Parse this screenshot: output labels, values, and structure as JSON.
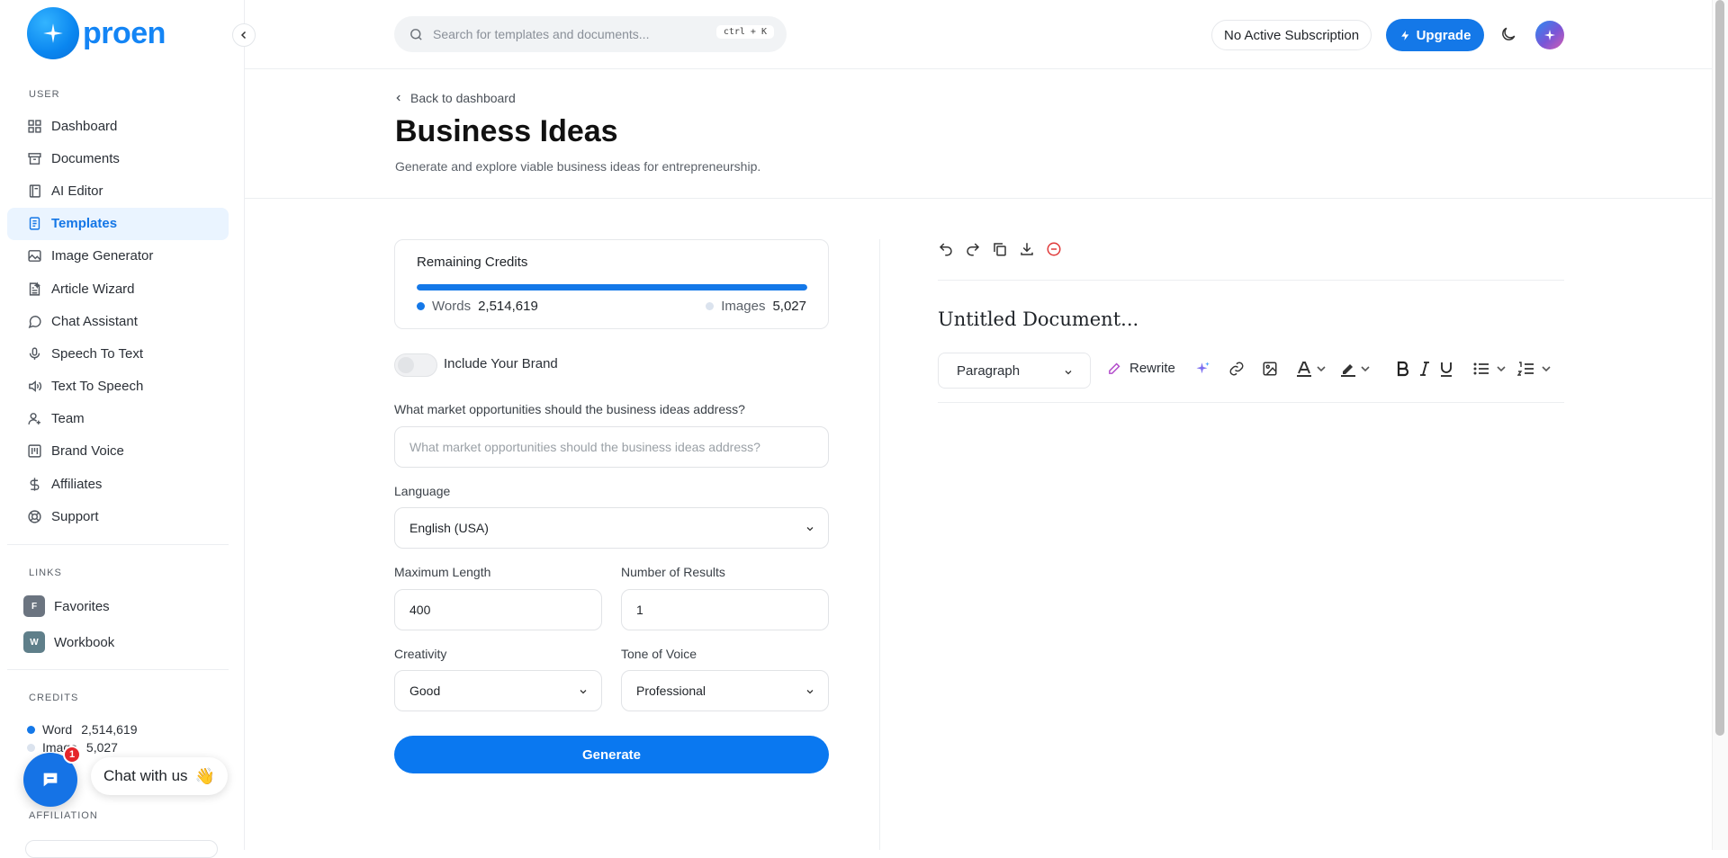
{
  "brand": {
    "name": "proen"
  },
  "sidebar": {
    "user_section": "USER",
    "items": [
      {
        "label": "Dashboard",
        "icon": "grid-icon"
      },
      {
        "label": "Documents",
        "icon": "archive-icon"
      },
      {
        "label": "AI Editor",
        "icon": "notebook-icon"
      },
      {
        "label": "Templates",
        "icon": "file-text-icon",
        "active": true
      },
      {
        "label": "Image Generator",
        "icon": "image-icon"
      },
      {
        "label": "Article Wizard",
        "icon": "article-icon"
      },
      {
        "label": "Chat Assistant",
        "icon": "chat-icon"
      },
      {
        "label": "Speech To Text",
        "icon": "mic-icon"
      },
      {
        "label": "Text To Speech",
        "icon": "speaker-icon"
      },
      {
        "label": "Team",
        "icon": "user-plus-icon"
      },
      {
        "label": "Brand Voice",
        "icon": "brand-icon"
      },
      {
        "label": "Affiliates",
        "icon": "dollar-icon"
      },
      {
        "label": "Support",
        "icon": "lifebuoy-icon"
      }
    ],
    "links_section": "LINKS",
    "links": [
      {
        "letter": "F",
        "label": "Favorites",
        "color": "#6b7480"
      },
      {
        "letter": "W",
        "label": "Workbook",
        "color": "#5f7f8a"
      }
    ],
    "credits_section": "CREDITS",
    "credits": [
      {
        "label": "Word",
        "value": "2,514,619",
        "color": "#1478e8"
      },
      {
        "label": "Image",
        "value": "5,027",
        "color": "#dbe3ee"
      }
    ],
    "affiliation_section": "AFFILIATION"
  },
  "chat": {
    "badge": "1",
    "label": "Chat with us",
    "emoji": "👋"
  },
  "topbar": {
    "search_placeholder": "Search for templates and documents...",
    "shortcut": "ctrl + K",
    "subscription": "No Active Subscription",
    "upgrade": "Upgrade"
  },
  "header": {
    "back": "Back to dashboard",
    "title": "Business Ideas",
    "subtitle": "Generate and explore viable business ideas for entrepreneurship."
  },
  "form": {
    "credits_title": "Remaining Credits",
    "words_label": "Words",
    "words_value": "2,514,619",
    "images_label": "Images",
    "images_value": "5,027",
    "words_fraction": 1.0,
    "brand_toggle": "Include Your Brand",
    "question_label": "What market opportunities should the business ideas address?",
    "question_placeholder": "What market opportunities should the business ideas address?",
    "language_label": "Language",
    "language_value": "English (USA)",
    "max_length_label": "Maximum Length",
    "max_length_value": "400",
    "results_label": "Number of Results",
    "results_value": "1",
    "creativity_label": "Creativity",
    "creativity_value": "Good",
    "tone_label": "Tone of Voice",
    "tone_value": "Professional",
    "generate": "Generate"
  },
  "editor": {
    "doc_title": "Untitled Document...",
    "block_type": "Paragraph",
    "rewrite": "Rewrite"
  }
}
